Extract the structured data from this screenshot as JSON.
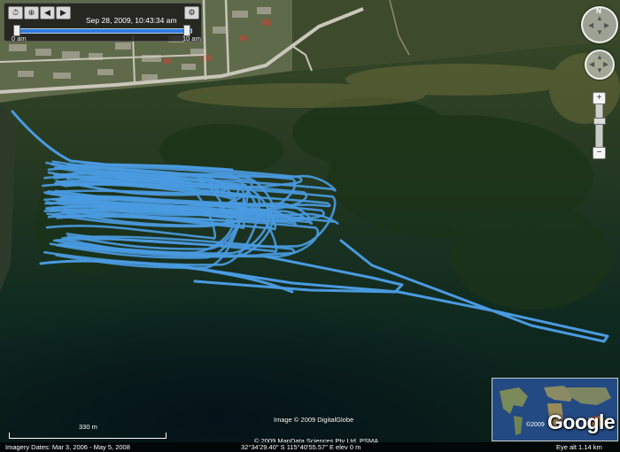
{
  "time_slider": {
    "current_date": "Sep 28, 2009, 10:43:34 am",
    "start_label": "0 am",
    "end_label": "10 am",
    "progress": 1.0
  },
  "nav": {
    "compass_label": "N",
    "zoom_in": "+",
    "zoom_out": "−"
  },
  "map": {
    "track_color": "#4a9ae0",
    "imagery_credit": "Image © 2009 DigitalGlobe",
    "data_credit": "© 2009 MapData Sciences Pty Ltd, PSMA",
    "scale_label": "330 m"
  },
  "status": {
    "imagery_dates": "Imagery Dates: Mar 3, 2006 - May 5, 2008",
    "coordinates": "32°34'29.40\" S    115°40'55.57\" E   elev   0 m",
    "eye_alt": "Eye alt    1.14 km"
  },
  "overview": {
    "brand": "Google",
    "year": "©2009"
  }
}
